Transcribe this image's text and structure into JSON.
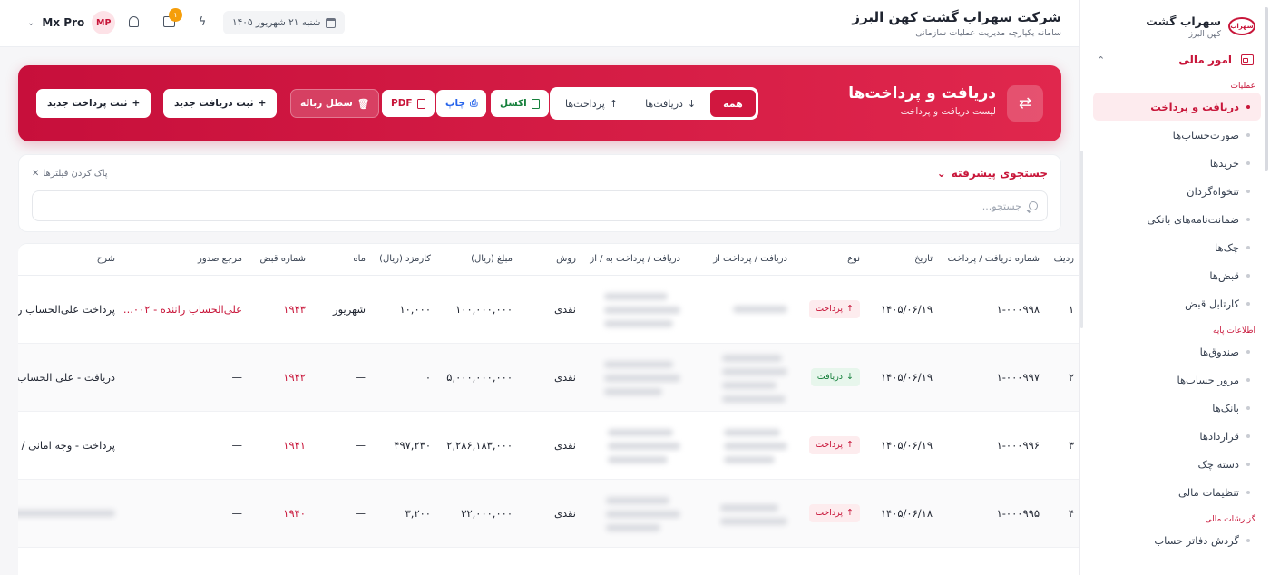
{
  "brand": {
    "title": "سهراب گشت",
    "subtitle": "کهن البرز",
    "logo_text": "سهراب"
  },
  "sidebar": {
    "section_label": "امور مالی",
    "groups": [
      {
        "title": "عملیات",
        "items": [
          "دریافت و پرداخت",
          "صورت‌حساب‌ها",
          "خریدها",
          "تنخواه‌گردان",
          "ضمانت‌نامه‌های بانکی",
          "چک‌ها",
          "قبض‌ها",
          "کارتابل قبض"
        ]
      },
      {
        "title": "اطلاعات پایه",
        "items": [
          "صندوق‌ها",
          "مرور حساب‌ها",
          "بانک‌ها",
          "قراردادها",
          "دسته چک",
          "تنظیمات مالی"
        ]
      },
      {
        "title": "گزارشات مالی",
        "items": [
          "گردش دفاتر حساب"
        ]
      }
    ]
  },
  "header": {
    "company_name": "شرکت سهراب گشت کهن البرز",
    "company_subtitle": "سامانه یکپارچه مدیریت عملیات سازمانی",
    "date": "شنبه ۲۱ شهریور ۱۴۰۵",
    "notification_count": "۱",
    "user_name": "Mx Pro",
    "user_initials": "MP"
  },
  "hero": {
    "title": "دریافت و پرداخت‌ها",
    "subtitle": "لیست دریافت و پرداخت",
    "filters": {
      "all": "همه",
      "receipts": "دریافت‌ها",
      "payments": "پرداخت‌ها"
    },
    "excel": "اکسل",
    "print": "چاپ",
    "pdf": "PDF",
    "trash": "سطل زباله",
    "new_receipt": "ثبت دریافت جدید",
    "new_payment": "ثبت پرداخت جدید"
  },
  "search": {
    "advanced_label": "جستجوی پیشرفته",
    "clear_label": "پاک کردن فیلترها",
    "placeholder": "جستجو..."
  },
  "table": {
    "headers": [
      "ردیف",
      "شماره دریافت / پرداخت",
      "تاریخ",
      "نوع",
      "دریافت / پرداخت از",
      "دریافت / پرداخت به / از",
      "روش",
      "مبلغ (ریال)",
      "کارمزد (ریال)",
      "ماه",
      "شماره قبض",
      "مرجع صدور",
      "شرح"
    ],
    "rows": [
      {
        "row": "۱",
        "number": "۱-۰۰۰۹۹۸",
        "date": "۱۴۰۵/۰۶/۱۹",
        "type": "پرداخت",
        "method": "نقدی",
        "amount": "۱۰۰,۰۰۰,۰۰۰",
        "fee": "۱۰,۰۰۰",
        "month": "شهریور",
        "receipt_no": "۱۹۴۳",
        "issuer": "علی‌الحساب راننده - ۰۰۲...",
        "description": "پرداخت علی‌الحساب راننده مه"
      },
      {
        "row": "۲",
        "number": "۱-۰۰۰۹۹۷",
        "date": "۱۴۰۵/۰۶/۱۹",
        "type": "دریافت",
        "method": "نقدی",
        "amount": "۵,۰۰۰,۰۰۰,۰۰۰",
        "fee": "۰",
        "month": "—",
        "receipt_no": "۱۹۴۲",
        "issuer": "—",
        "description": "دریافت - علی الحساب صورت"
      },
      {
        "row": "۳",
        "number": "۱-۰۰۰۹۹۶",
        "date": "۱۴۰۵/۰۶/۱۹",
        "type": "پرداخت",
        "method": "نقدی",
        "amount": "۲,۲۸۶,۱۸۳,۰۰۰",
        "fee": "۴۹۷,۲۳۰",
        "month": "—",
        "receipt_no": "۱۹۴۱",
        "issuer": "—",
        "description": "پرداخت - وجه امانی / قرض الـ"
      },
      {
        "row": "۴",
        "number": "۱-۰۰۰۹۹۵",
        "date": "۱۴۰۵/۰۶/۱۸",
        "type": "پرداخت",
        "method": "نقدی",
        "amount": "۳۲,۰۰۰,۰۰۰",
        "fee": "۳,۲۰۰",
        "month": "—",
        "receipt_no": "۱۹۴۰",
        "issuer": "—",
        "description": ""
      }
    ]
  },
  "colors": {
    "accent": "#c8163a",
    "receive": "#16803c",
    "print": "#2563eb"
  }
}
